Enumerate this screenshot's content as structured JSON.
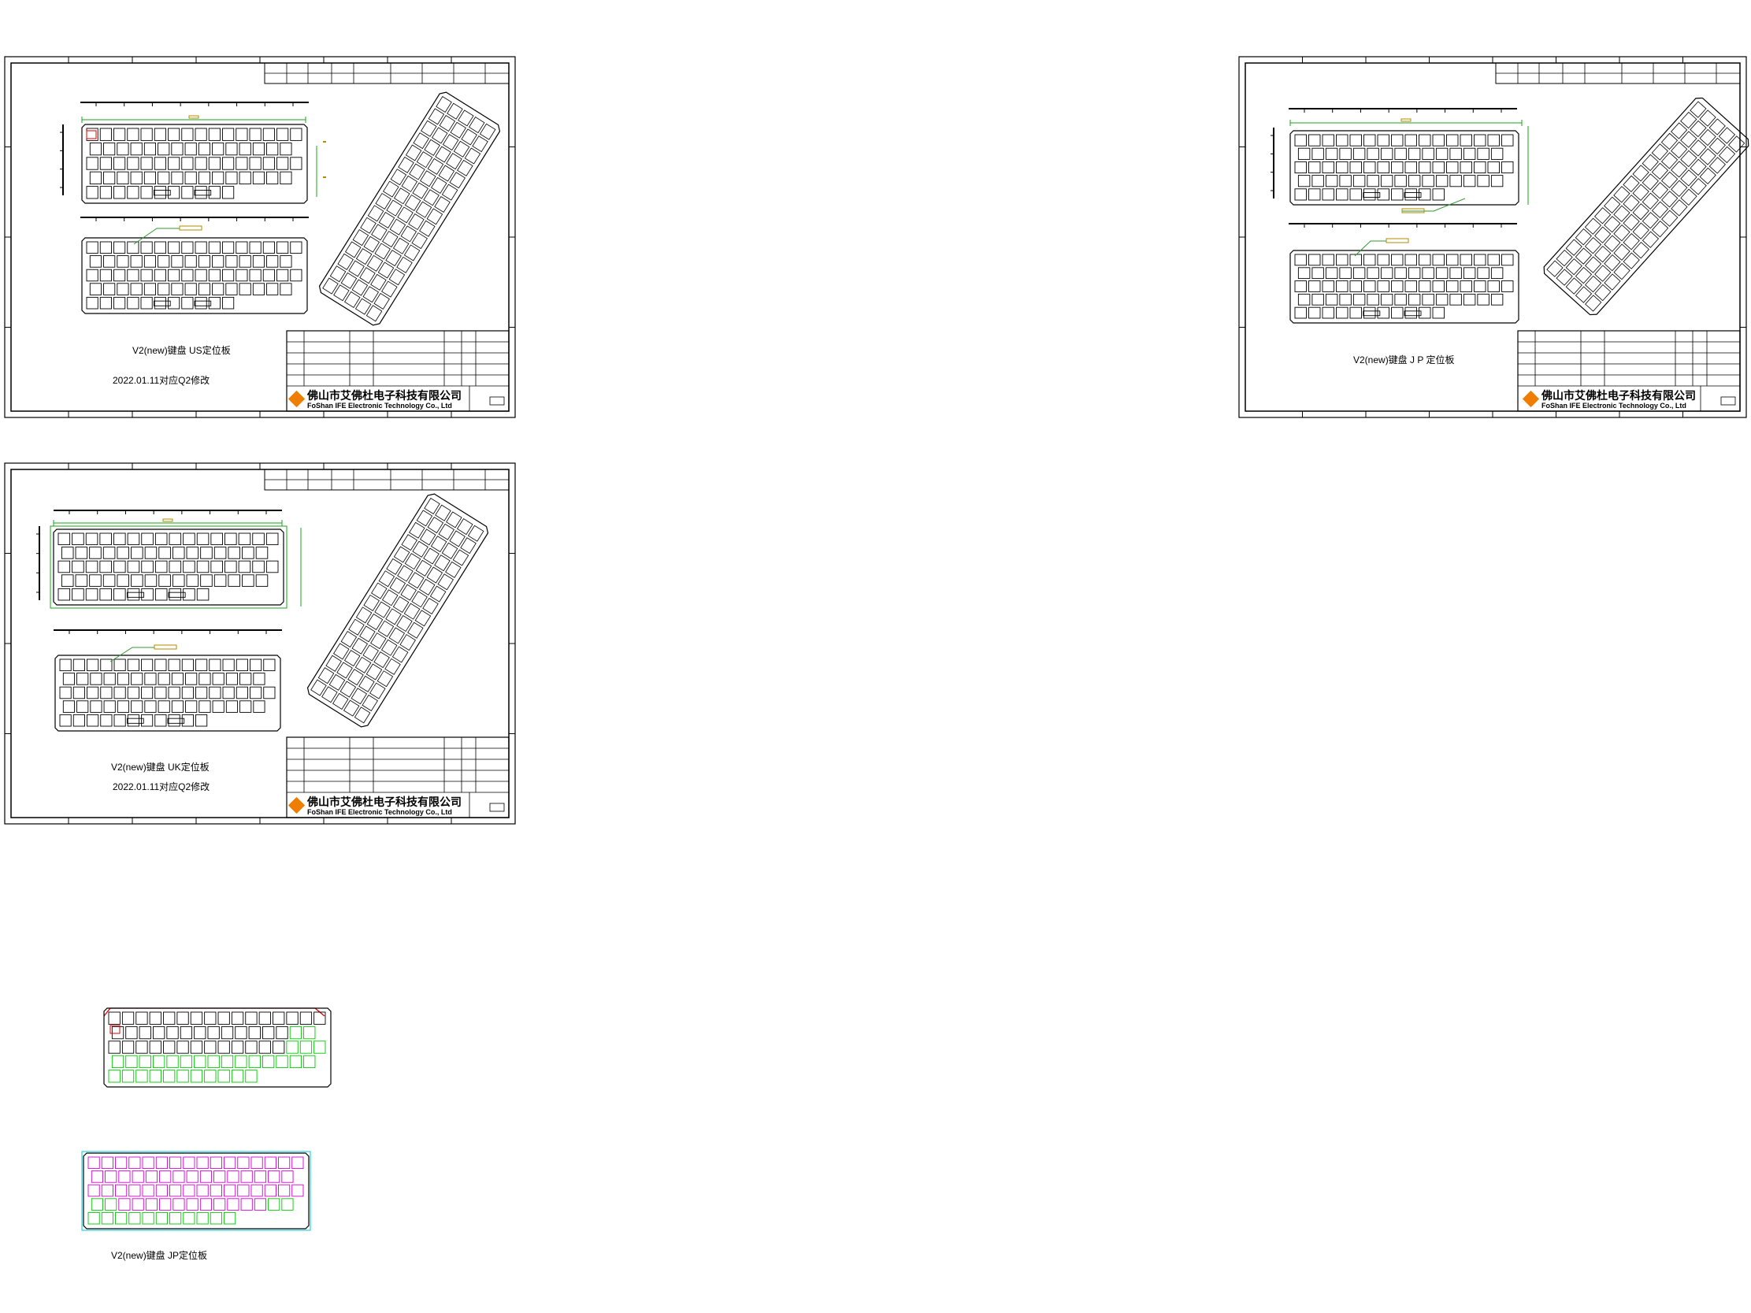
{
  "drawing": {
    "company_cn": "佛山市艾佛杜电子科技有限公司",
    "company_en": "FoShan IFE Electronic Technology Co., Ltd",
    "palette": {
      "line": "#000000",
      "dimension": "#1aa31a",
      "dimension_text": "#b38a00",
      "callout": "#2f9a2f",
      "title_accent": "#00c8d8",
      "logo": "#ef7d00",
      "overlay_red": "#e00000",
      "overlay_green": "#00c800",
      "overlay_magenta": "#d400d4",
      "overlay_cyan": "#00c8d8"
    },
    "sheets": [
      {
        "id": "us",
        "label": "V2(new)键盘 US定位板",
        "note": "2022.01.11对应Q2修改"
      },
      {
        "id": "jp",
        "label": "V2(new)键盘 J P 定位板"
      },
      {
        "id": "uk",
        "label": "V2(new)键盘 UK定位板",
        "note": "2022.01.11对应Q2修改"
      }
    ],
    "overlay_label": "V2(new)键盘 JP定位板"
  }
}
